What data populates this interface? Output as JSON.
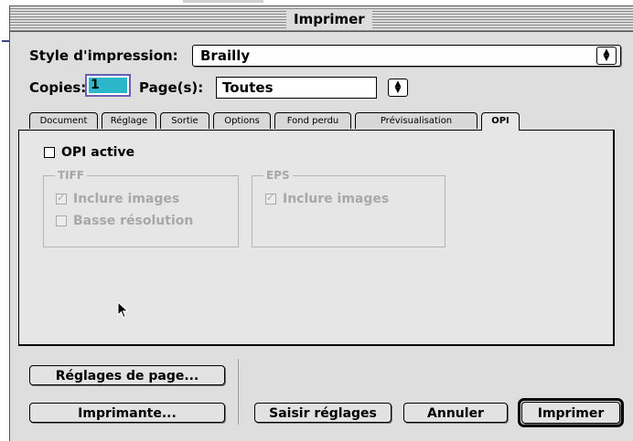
{
  "window": {
    "title": "Imprimer"
  },
  "print_style": {
    "label": "Style d'impression:",
    "value": "Brailly"
  },
  "copies": {
    "label": "Copies:",
    "value": "1"
  },
  "pages": {
    "label": "Page(s):",
    "value": "Toutes"
  },
  "tabs": [
    {
      "label": "Document"
    },
    {
      "label": "Réglage"
    },
    {
      "label": "Sortie"
    },
    {
      "label": "Options"
    },
    {
      "label": "Fond perdu"
    },
    {
      "label": "Prévisualisation"
    },
    {
      "label": "OPI",
      "active": true
    }
  ],
  "opi": {
    "active_label": "OPI active",
    "active_checked": false,
    "tiff": {
      "title": "TIFF",
      "include_images_label": "Inclure images",
      "include_images_checked": true,
      "low_res_label": "Basse résolution",
      "low_res_checked": false
    },
    "eps": {
      "title": "EPS",
      "include_images_label": "Inclure images",
      "include_images_checked": true
    }
  },
  "buttons": {
    "page_setup": "Réglages de page...",
    "printer": "Imprimante...",
    "capture_settings": "Saisir réglages",
    "cancel": "Annuler",
    "print": "Imprimer"
  }
}
